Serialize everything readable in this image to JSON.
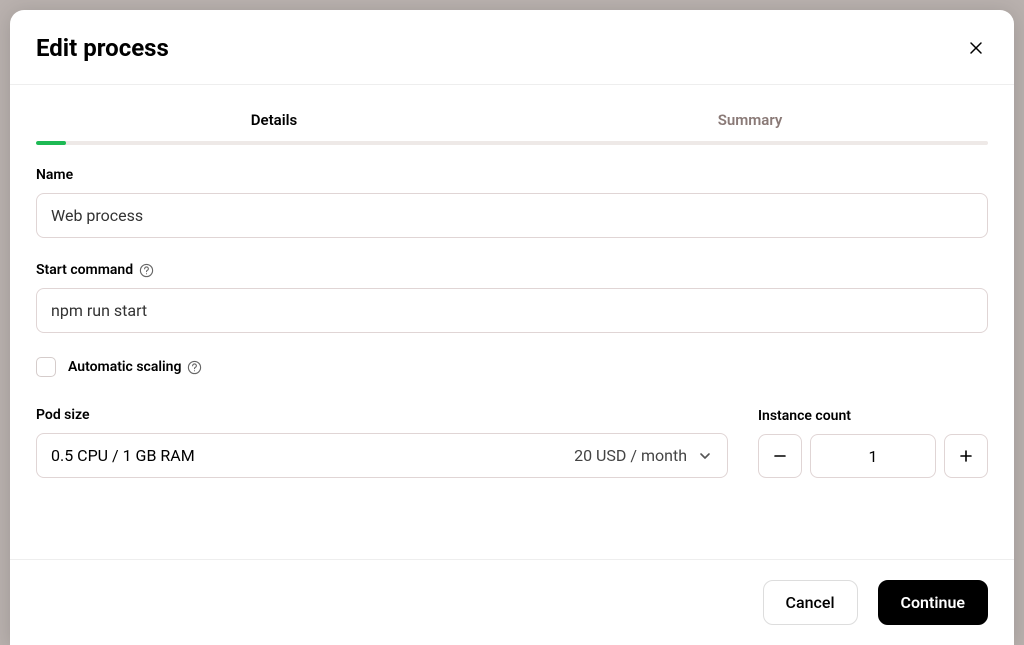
{
  "modal": {
    "title": "Edit process"
  },
  "tabs": {
    "details": "Details",
    "summary": "Summary"
  },
  "form": {
    "name_label": "Name",
    "name_value": "Web process",
    "command_label": "Start command",
    "command_value": "npm run start",
    "autoscale_label": "Automatic scaling",
    "podsize_label": "Pod size",
    "podsize_value": "0.5 CPU / 1 GB RAM",
    "podsize_price": "20 USD / month",
    "instance_label": "Instance count",
    "instance_value": "1"
  },
  "footer": {
    "cancel": "Cancel",
    "continue": "Continue"
  }
}
